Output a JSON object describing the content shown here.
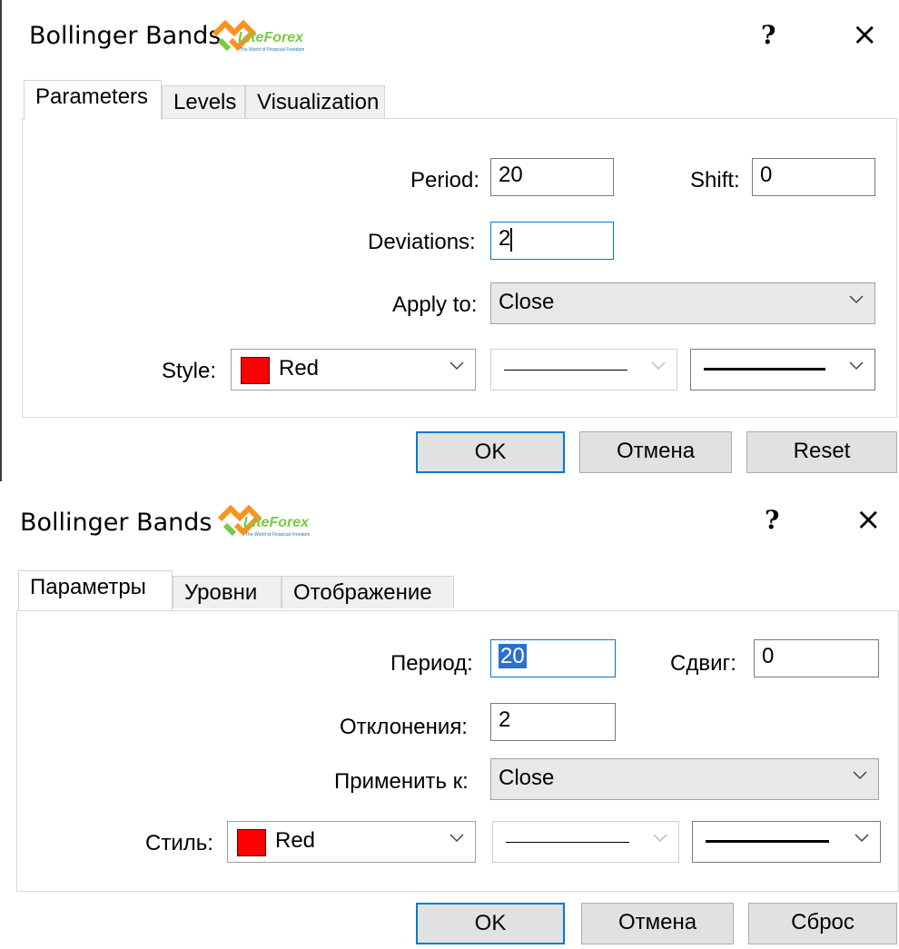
{
  "dialogs": [
    {
      "title": "Bollinger Bands",
      "logo_text": "LiteForex",
      "logo_tagline": "The World of Financial Freedom",
      "help": "?",
      "close": "×",
      "tabs": [
        "Parameters",
        "Levels",
        "Visualization"
      ],
      "period_label": "Period:",
      "period_value": "20",
      "shift_label": "Shift:",
      "shift_value": "0",
      "deviations_label": "Deviations:",
      "deviations_value": "2",
      "apply_label": "Apply to:",
      "apply_value": "Close",
      "style_label": "Style:",
      "color_name": "Red",
      "ok": "OK",
      "cancel": "Отмена",
      "reset": "Reset"
    },
    {
      "title": "Bollinger Bands",
      "logo_text": "LiteForex",
      "logo_tagline": "The World of Financial Freedom",
      "help": "?",
      "close": "×",
      "tabs": [
        "Параметры",
        "Уровни",
        "Отображение"
      ],
      "period_label": "Период:",
      "period_value": "20",
      "shift_label": "Сдвиг:",
      "shift_value": "0",
      "deviations_label": "Отклонения:",
      "deviations_value": "2",
      "apply_label": "Применить к:",
      "apply_value": "Close",
      "style_label": "Стиль:",
      "color_name": "Red",
      "ok": "OK",
      "cancel": "Отмена",
      "reset": "Сброс"
    }
  ],
  "colors": {
    "accent": "#0078d7",
    "swatch": "#ff0000",
    "logo_green": "#7ac943",
    "logo_orange": "#f7941d",
    "logo_blue": "#1a75bb"
  }
}
